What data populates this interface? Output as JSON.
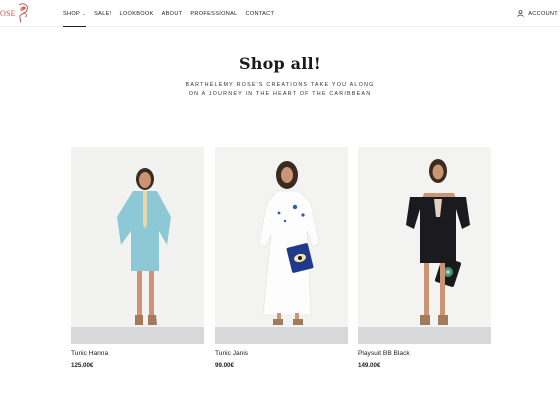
{
  "header": {
    "logo_text": "OSE",
    "nav": [
      {
        "label": "SHOP",
        "active": true,
        "has_dropdown": true
      },
      {
        "label": "SALE!"
      },
      {
        "label": "LOOKBOOK"
      },
      {
        "label": "ABOUT"
      },
      {
        "label": "PROFESSIONAL"
      },
      {
        "label": "CONTACT"
      }
    ],
    "account_label": "ACCOUNT",
    "account_icon": "user-icon"
  },
  "main": {
    "title": "Shop all!",
    "subtitle": "BARTHÉLEMY ROSE'S CREATIONS TAKE YOU ALONG ON A JOURNEY IN THE HEART OF THE CARIBBEAN"
  },
  "products": [
    {
      "name": "Tunic Hanna",
      "price": "125.00€",
      "garment_color": "#8cc8d6"
    },
    {
      "name": "Tunic Janis",
      "price": "99.00€",
      "garment_color": "#ffffff"
    },
    {
      "name": "Playsuit BB Black",
      "price": "149.00€",
      "garment_color": "#1b1b1f"
    }
  ],
  "colors": {
    "accent": "#c1554a",
    "text": "#222222"
  }
}
